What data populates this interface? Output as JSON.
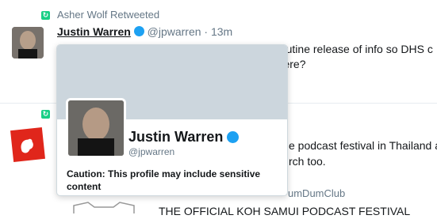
{
  "tweet1": {
    "retweeted_by": "Asher Wolf Retweeted",
    "name": "Justin Warren",
    "handle": "@jpwarren",
    "separator": "·",
    "time": "13m",
    "text_line1": "I'm on, it's supposed to be an exception, not routine release of info so DHS c",
    "text_line2": "n here?"
  },
  "tweet2": {
    "text_line1": "e podcast festival in Thailand a",
    "text_line2": "rch too.",
    "second_name": "umDumClub",
    "bottom_text": "THE OFFICIAL KOH SAMUI PODCAST FESTIVAL"
  },
  "hovercard": {
    "name": "Justin Warren",
    "handle": "@jpwarren",
    "caution": "Caution: This profile may include sensitive content"
  },
  "colors": {
    "retweet_green": "#19cf86",
    "verified_blue": "#1da1f2",
    "muted_text": "#657786",
    "card_banner": "#ccd6dd",
    "squirrel_red": "#e0261b"
  },
  "icons": [
    "retweet-icon",
    "verified-badge-icon",
    "squirrel-logo-icon"
  ]
}
